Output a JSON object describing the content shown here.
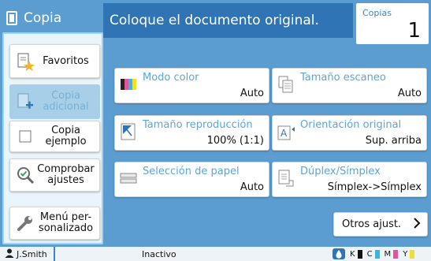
{
  "header": {
    "app_title": "Copia",
    "message": "Coloque el documento original.",
    "copies_label": "Copias",
    "copies_value": "1"
  },
  "left_panel": {
    "items": [
      {
        "label": "Favoritos",
        "icon": "favorites-icon",
        "enabled": true
      },
      {
        "label": "Copia adicional",
        "icon": "add-copy-icon",
        "enabled": false
      },
      {
        "label": "Copia ejemplo",
        "icon": "checkbox-icon",
        "enabled": true
      },
      {
        "label": "Comprobar ajustes",
        "icon": "magnifier-check-icon",
        "enabled": true
      },
      {
        "label": "Menú personalizado",
        "label_display": "Menú per-\nsonalizado",
        "icon": "wrench-icon",
        "enabled": true
      }
    ]
  },
  "settings": [
    {
      "label": "Modo color",
      "value": "Auto",
      "icon": "color-mode-icon"
    },
    {
      "label": "Tamaño escaneo",
      "value": "Auto",
      "icon": "scan-size-icon"
    },
    {
      "label": "Tamaño reproducción",
      "value": "100% (1:1)",
      "icon": "reproduction-size-icon"
    },
    {
      "label": "Orientación original",
      "value": "Sup. arriba",
      "icon": "orientation-icon"
    },
    {
      "label": "Selección de papel",
      "value": "Auto",
      "icon": "paper-select-icon"
    },
    {
      "label": "Dúplex/Símplex",
      "value": "Símplex->Símplex",
      "icon": "duplex-icon"
    }
  ],
  "other_settings_label": "Otros ajust.",
  "status_bar": {
    "user": "J.Smith",
    "status": "Inactivo",
    "inks": [
      {
        "label": "K",
        "color": "#111111"
      },
      {
        "label": "C",
        "color": "#35b6e6"
      },
      {
        "label": "M",
        "color": "#e0559e"
      },
      {
        "label": "Y",
        "color": "#f2de2c"
      }
    ]
  },
  "colors": {
    "background": "#5b9dd0",
    "message_bar": "#2f75b5",
    "label_blue": "#5aa6da",
    "panel_highlight": "#9fd3f4"
  }
}
